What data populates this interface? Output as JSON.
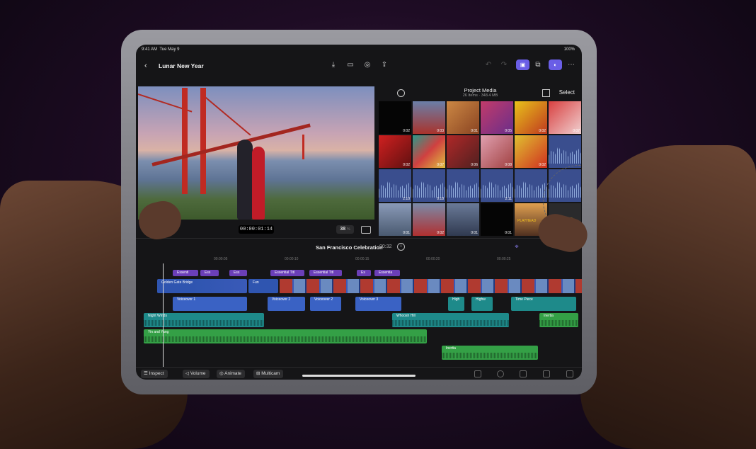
{
  "status": {
    "time": "9:41 AM",
    "date": "Tue May 9",
    "battery": "100%"
  },
  "project": {
    "title": "Lunar New Year"
  },
  "viewer": {
    "timecode": "00:00:01:14",
    "zoom": "38",
    "zoom_unit": "%"
  },
  "browser": {
    "title": "Project Media",
    "subtitle": "26 Items · 348.4 MB",
    "select_label": "Select",
    "playhead_tag": "PLAYHEAD",
    "durations": [
      "0:02",
      "0:03",
      "0:01",
      "0:05",
      "0:02",
      "0:07",
      "0:02",
      "0:07",
      "0:06",
      "0:08",
      "0:02",
      "2:10",
      "0:18",
      "2:11",
      "0:01",
      "0:02",
      "0:01",
      "0:01"
    ]
  },
  "timeline": {
    "title": "San Francisco Celebration",
    "duration": "00:32",
    "ruler": [
      "00:00:05",
      "00:00:10",
      "00:00:15",
      "00:00:20",
      "00:00:25"
    ],
    "title_clips": [
      "Essenti",
      "Ess",
      "Ess",
      "Essential Titl",
      "Essential Titl",
      "Es",
      "Essentia"
    ],
    "video_clips": [
      "Golden Gate Bridge",
      "Fun"
    ],
    "voiceovers": [
      "Voiceover 1",
      "Voiceover 2",
      "Voiceover 2",
      "Voiceover 3",
      "High",
      "Highw",
      "Time Piece"
    ],
    "music": [
      "Night Winds",
      "Whoosh Hill",
      "Inertia"
    ],
    "songs": [
      "Yin and Yang",
      "Inertia"
    ]
  },
  "toolbar": {
    "inspect": "Inspect",
    "volume": "Volume",
    "animate": "Animate",
    "multicam": "Multicam"
  },
  "colors": {
    "accent": "#6a5ee6",
    "video": "#2f55b0",
    "titles": "#6b3fb8",
    "music": "#1e8a8a",
    "song": "#34a046",
    "playhead": "#f0c020"
  }
}
